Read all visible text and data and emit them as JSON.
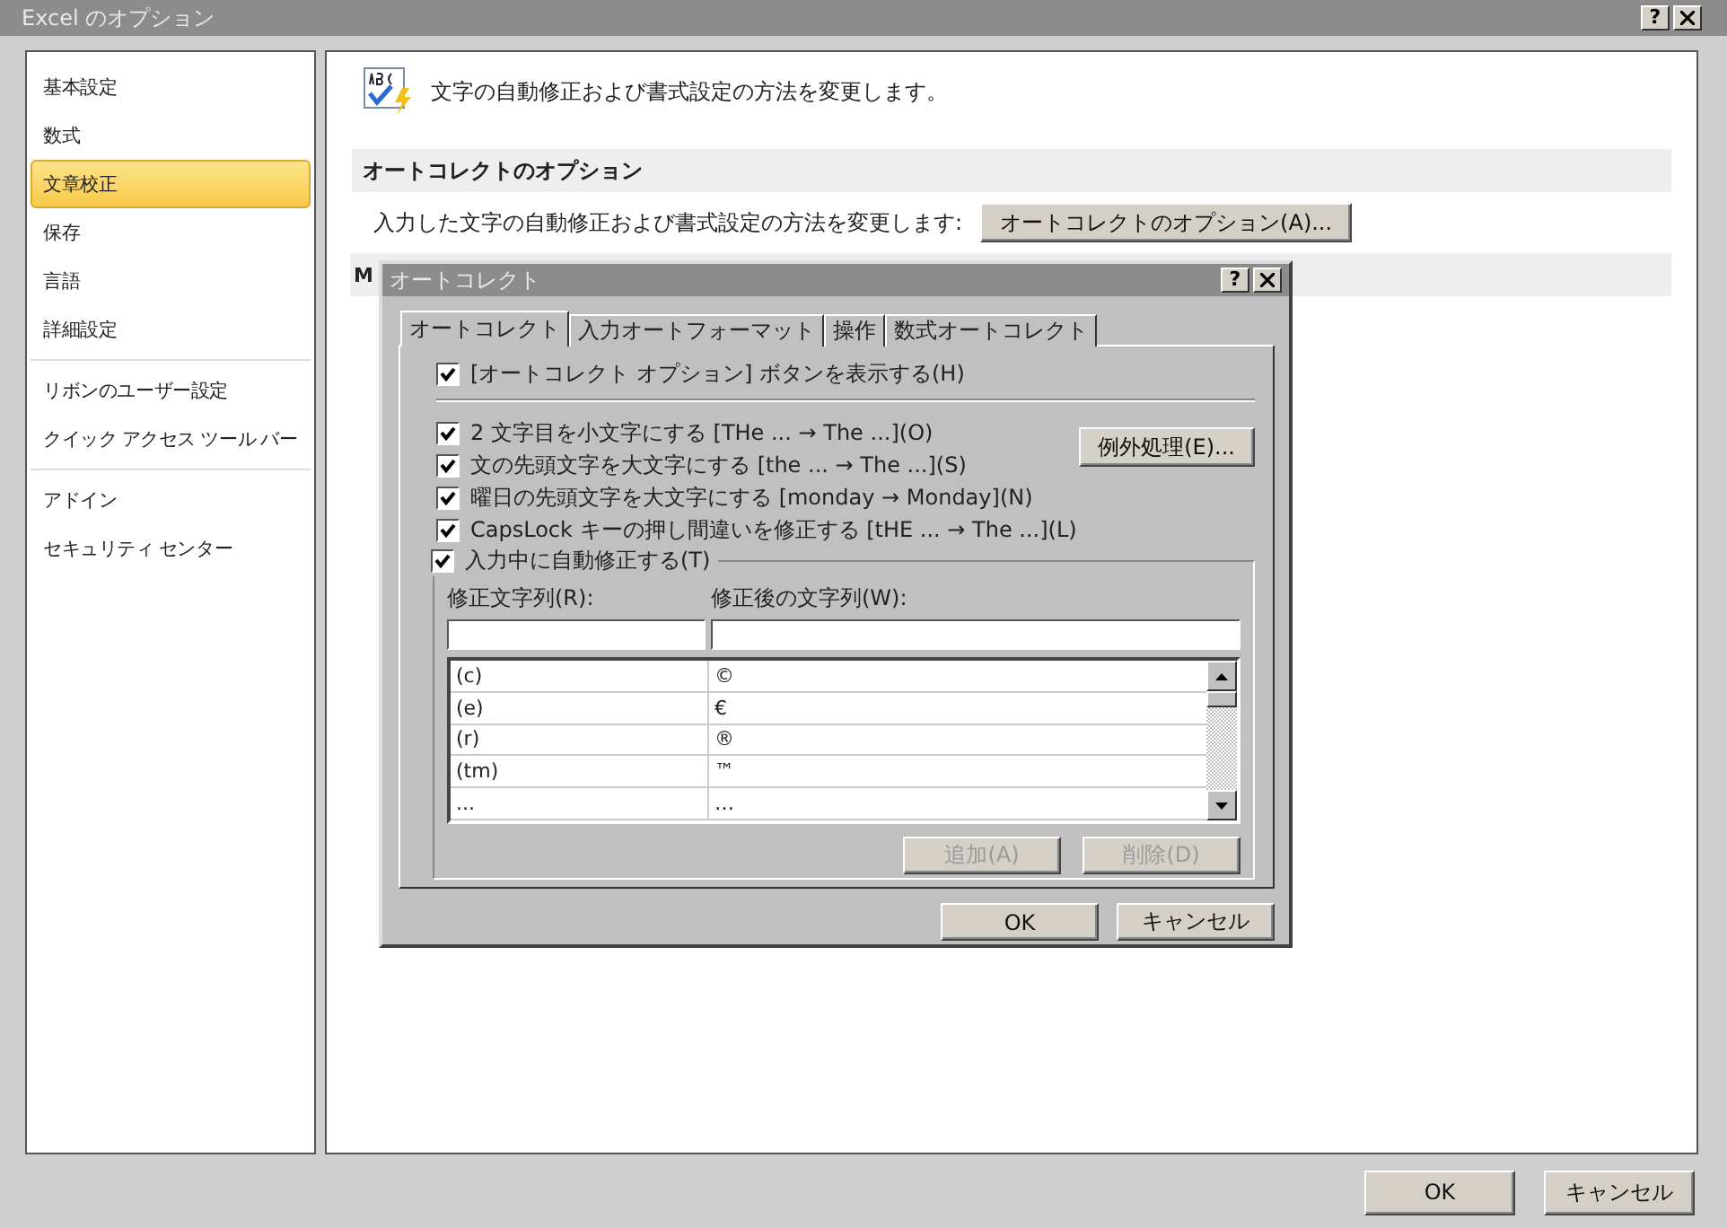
{
  "window": {
    "title": "Excel のオプション",
    "help": "?"
  },
  "sidebar": {
    "groups": [
      [
        {
          "label": "基本設定",
          "selected": false
        },
        {
          "label": "数式",
          "selected": false
        },
        {
          "label": "文章校正",
          "selected": true
        },
        {
          "label": "保存",
          "selected": false
        },
        {
          "label": "言語",
          "selected": false
        },
        {
          "label": "詳細設定",
          "selected": false
        }
      ],
      [
        {
          "label": "リボンのユーザー設定",
          "selected": false
        },
        {
          "label": "クイック アクセス ツール バー",
          "selected": false
        }
      ],
      [
        {
          "label": "アドイン",
          "selected": false
        },
        {
          "label": "セキュリティ センター",
          "selected": false
        }
      ]
    ]
  },
  "content": {
    "heading": "文字の自動修正および書式設定の方法を変更します。",
    "section": "オートコレクトのオプション",
    "option_text": "入力した文字の自動修正および書式設定の方法を変更します:",
    "option_button": "オートコレクトのオプション(A)...",
    "section_2": "M"
  },
  "buttons": [
    "OK",
    "キャンセル"
  ],
  "dialog": {
    "title": "オートコレクト",
    "help": "?",
    "tabs": [
      {
        "label": "オートコレクト",
        "selected": true
      },
      {
        "label": "入力オートフォーマット",
        "selected": false
      },
      {
        "label": "操作",
        "selected": false
      },
      {
        "label": "数式オートコレクト",
        "selected": false
      }
    ],
    "show_button_option": {
      "label": "[オートコレクト オプション] ボタンを表示する(H)",
      "checked": true
    },
    "options": [
      {
        "label": "2 文字目を小文字にする [THe ... → The ...](O)",
        "checked": true
      },
      {
        "label": "文の先頭文字を大文字にする [the ... → The ...](S)",
        "checked": true
      },
      {
        "label": "曜日の先頭文字を大文字にする [monday → Monday](N)",
        "checked": true
      },
      {
        "label": "CapsLock キーの押し間違いを修正する [tHE ... → The ...](L)",
        "checked": true
      }
    ],
    "exceptions_button": "例外処理(E)...",
    "replace_as_you_type": {
      "label": "入力中に自動修正する(T)",
      "checked": true
    },
    "replace_label": "修正文字列(R):",
    "with_label": "修正後の文字列(W):",
    "entries": [
      {
        "replace": "(c)",
        "with": "©"
      },
      {
        "replace": "(e)",
        "with": "€"
      },
      {
        "replace": "(r)",
        "with": "®"
      },
      {
        "replace": "(tm)",
        "with": "™"
      },
      {
        "replace": "...",
        "with": "…"
      }
    ],
    "add_button": {
      "label": "追加(A)",
      "disabled": true
    },
    "delete_button": {
      "label": "削除(D)",
      "disabled": true
    },
    "buttons": [
      "OK",
      "キャンセル"
    ]
  }
}
